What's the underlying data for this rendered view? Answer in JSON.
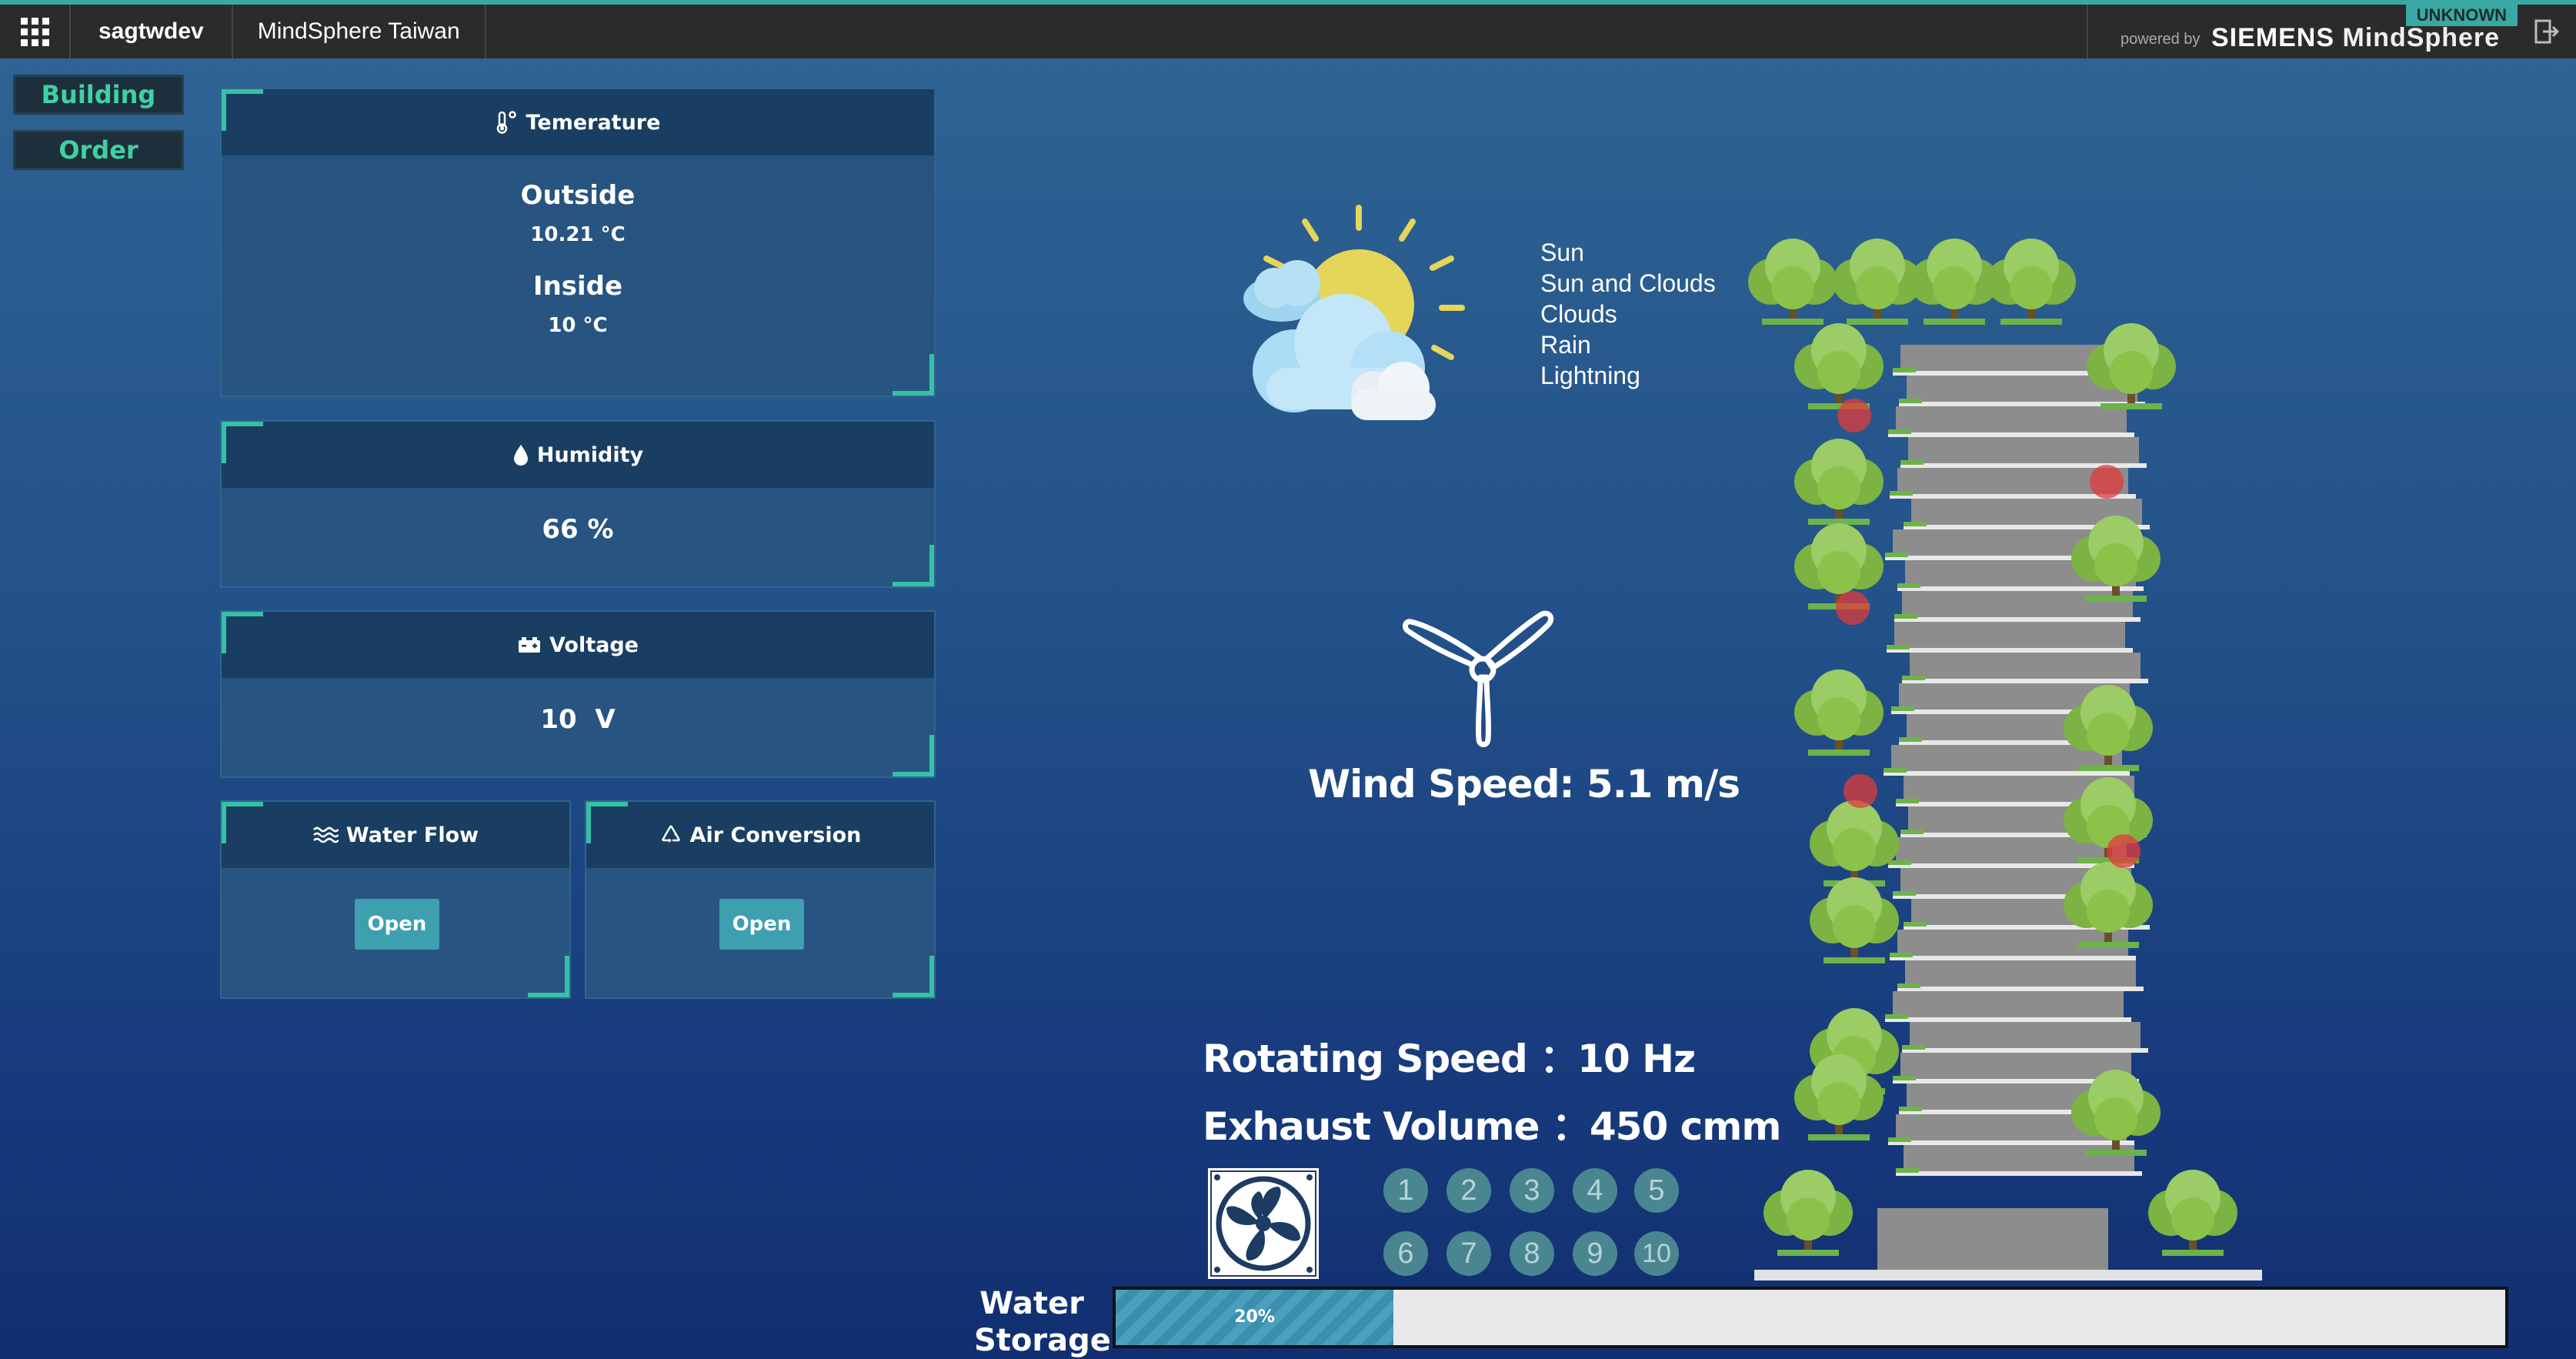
{
  "topbar": {
    "tenant": "sagtwdev",
    "app_name": "MindSphere Taiwan",
    "status_badge": "UNKNOWN",
    "powered_by": "powered by",
    "brand": "SIEMENS",
    "brand_product": "MindSphere"
  },
  "nav": {
    "building": "Building",
    "order": "Order"
  },
  "temperature": {
    "title": "Temerature",
    "outside_label": "Outside",
    "outside_value": "10.21 °C",
    "inside_label": "Inside",
    "inside_value": "10 °C"
  },
  "humidity": {
    "title": "Humidity",
    "value": "66 %"
  },
  "voltage": {
    "title": "Voltage",
    "value": "10  V"
  },
  "water_flow": {
    "title": "Water Flow",
    "button": "Open"
  },
  "air_conversion": {
    "title": "Air Conversion",
    "button": "Open"
  },
  "weather": {
    "options": [
      "Sun",
      "Sun and Clouds",
      "Clouds",
      "Rain",
      "Lightning"
    ]
  },
  "wind": {
    "label": "Wind Speed: 5.1 m/s"
  },
  "fan": {
    "rotating_speed": "Rotating Speed ：10 Hz",
    "exhaust_volume": "Exhaust Volume ：450 cmm",
    "levels": [
      "1",
      "2",
      "3",
      "4",
      "5",
      "6",
      "7",
      "8",
      "9",
      "10"
    ]
  },
  "water_storage": {
    "label_line1": "Water",
    "label_line2": "Storage",
    "percent": 20,
    "percent_label": "20%"
  },
  "colors": {
    "accent": "#36c0a6",
    "topbar": "#2b2b2b",
    "card": "#275480",
    "card_header": "#193e61",
    "button": "#3e9fb1",
    "nav_text": "#3fd0a4"
  }
}
